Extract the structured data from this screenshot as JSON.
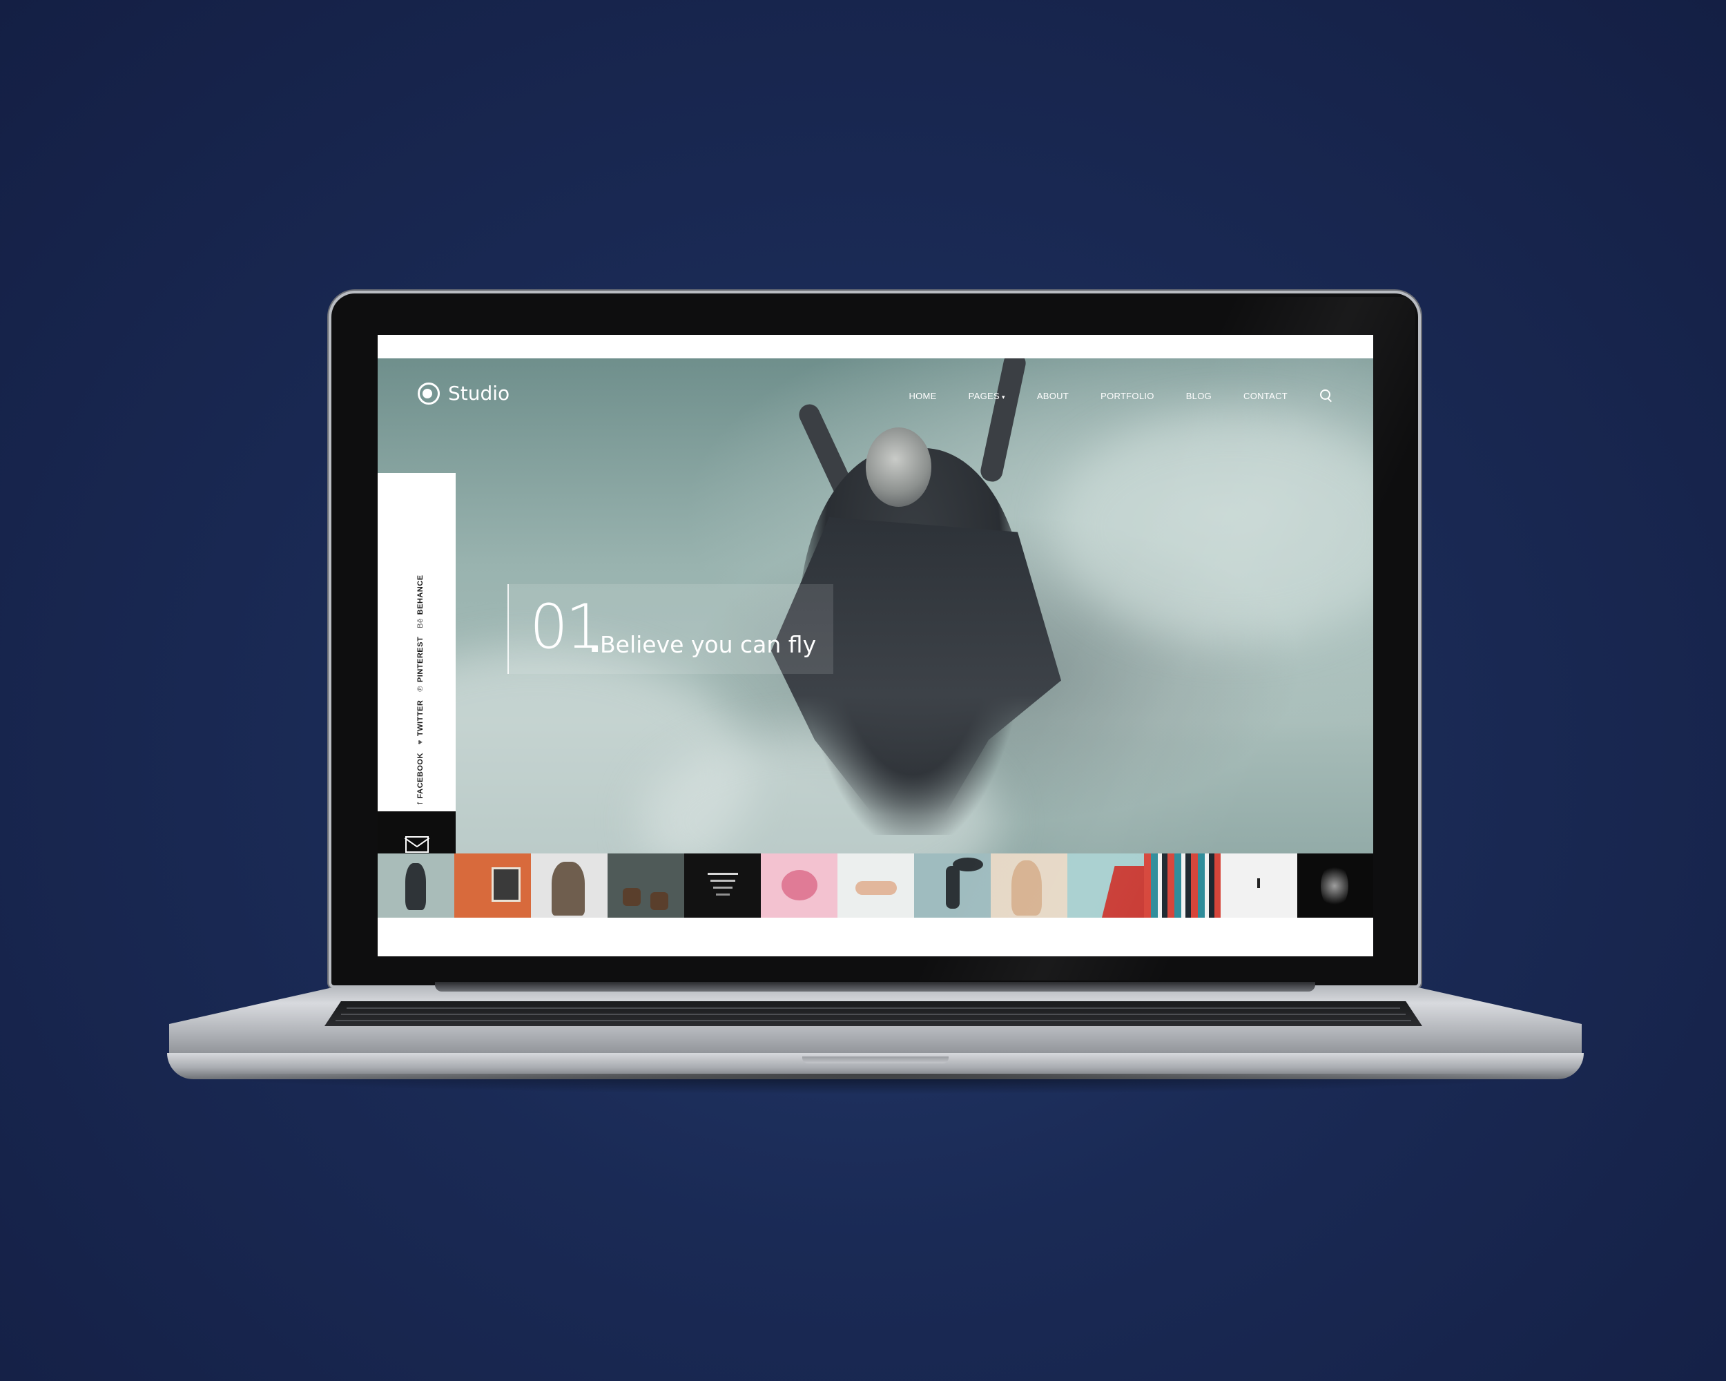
{
  "brand": {
    "name": "Studio"
  },
  "nav": {
    "items": [
      {
        "label": "HOME"
      },
      {
        "label": "PAGES",
        "caret": "▾"
      },
      {
        "label": "ABOUT"
      },
      {
        "label": "PORTFOLIO"
      },
      {
        "label": "BLOG"
      },
      {
        "label": "CONTACT"
      }
    ],
    "search_icon": "search-icon"
  },
  "social": [
    {
      "label": "FACEBOOK",
      "glyph": "f"
    },
    {
      "label": "TWITTER",
      "glyph": "♥"
    },
    {
      "label": "PINTEREST",
      "glyph": "℗"
    },
    {
      "label": "BEHANCE",
      "glyph": "Bē"
    }
  ],
  "contact_icon": "mail-icon",
  "slide": {
    "number": "01",
    "dot": ".",
    "title": "Believe you can fly"
  },
  "thumbnails": [
    {
      "subject": "dancer in fog",
      "bg": "#a9bcb9"
    },
    {
      "subject": "orange wall window",
      "bg": "#d86a3c"
    },
    {
      "subject": "deer",
      "bg": "#e4e4e4"
    },
    {
      "subject": "boots on snow",
      "bg": "#4f5a58"
    },
    {
      "subject": "dark stairs",
      "bg": "#121212"
    },
    {
      "subject": "lips in paper",
      "bg": "#f3c2d0"
    },
    {
      "subject": "hand",
      "bg": "#ecefee"
    },
    {
      "subject": "figure with fabric",
      "bg": "#9fbcbf"
    },
    {
      "subject": "woman by curtain",
      "bg": "#e6d8c6"
    },
    {
      "subject": "red building",
      "bg": "#a7cfcf"
    },
    {
      "subject": "colorful facade",
      "bg": "#6a7c80"
    },
    {
      "subject": "person in snow",
      "bg": "#f2f2f2"
    },
    {
      "subject": "smoke portrait",
      "bg": "#0b0b0b"
    }
  ],
  "colors": {
    "background": "#1a2a55",
    "hero_tint": "#99b3af",
    "panel_dark": "#0d0d0d",
    "text_light": "#ffffff"
  }
}
